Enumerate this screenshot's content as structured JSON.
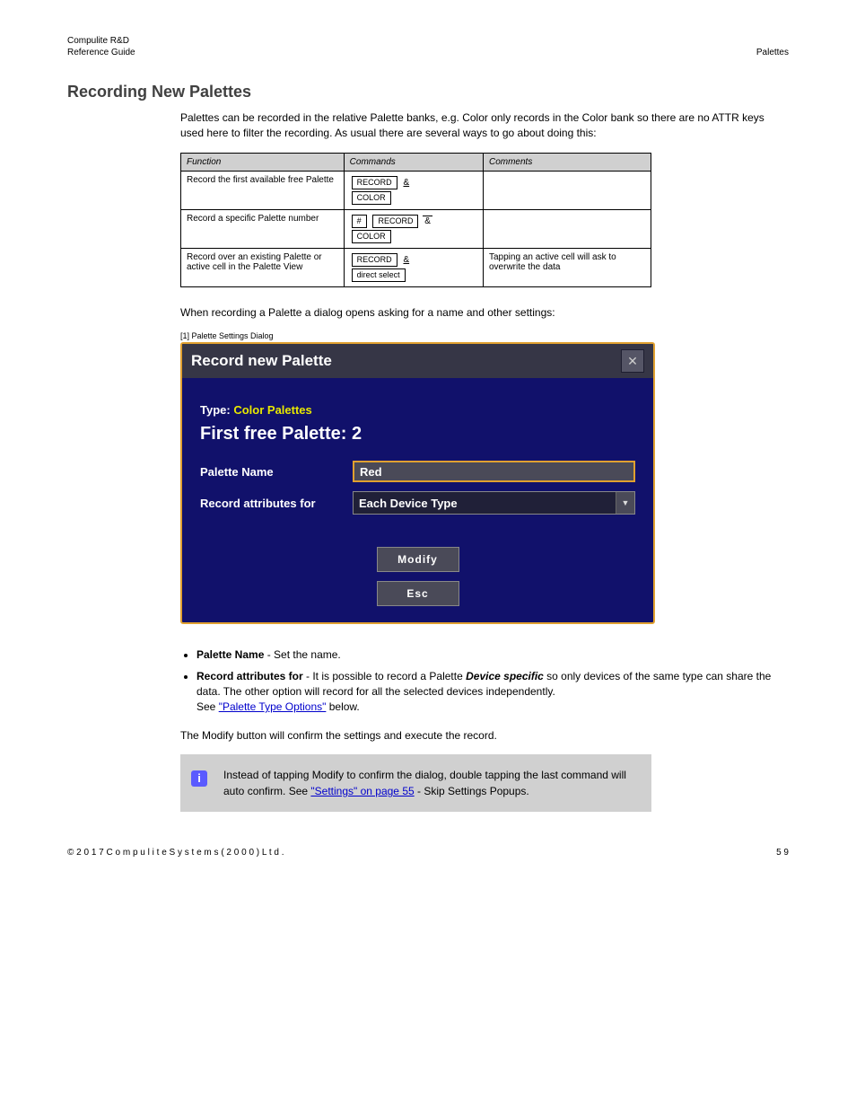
{
  "header": {
    "product": "Compulite R&D",
    "left": "Reference Guide",
    "right": "Palettes"
  },
  "section_title": "Recording New Palettes",
  "para1": "Palettes can be recorded in the relative Palette banks, e.g. Color only records in the Color bank so there are no ATTR keys used here to filter the recording. As usual there are several ways to go about doing this:",
  "table_headers": {
    "c1": "Function",
    "c2": "Commands",
    "c3": "Comments"
  },
  "rows": [
    {
      "func": "Record the first available free Palette",
      "keys_a": [
        "RECORD"
      ],
      "amp_a": "&",
      "keys_b": [
        "COLOR"
      ],
      "comment": ""
    },
    {
      "func": "Record a specific Palette number",
      "keys_a": [
        "#",
        "RECORD"
      ],
      "amp_a": "&",
      "overbar_a": true,
      "keys_b": [
        "COLOR"
      ],
      "comment": ""
    },
    {
      "func": "Record over an existing Palette or active cell in the Palette View",
      "keys_a": [
        "RECORD"
      ],
      "amp_a": "&",
      "keys_b": [
        "direct select"
      ],
      "comment": "Tapping an active cell will ask to overwrite the data"
    }
  ],
  "para2": "When recording a Palette a dialog opens asking for a name and other settings:",
  "dlg_label": "[1] Palette Settings Dialog",
  "dialog": {
    "title": "Record new Palette",
    "type_label": "Type:",
    "type_value": "Color Palettes",
    "first_free": "First free Palette: 2",
    "field_name_label": "Palette Name",
    "field_name_value": "Red",
    "field_attr_label": "Record attributes for",
    "field_attr_value": "Each Device Type",
    "btn_modify": "Modify",
    "btn_esc": "Esc"
  },
  "legend": [
    {
      "term": "Palette Name",
      "text": " - Set the name."
    },
    {
      "term": "Record attributes for",
      "pre": " - It is possible to record a Palette ",
      "ital": "Device specific",
      "post": " so only devices of the same type can share the data. The other option will record for all the selected devices independently."
    }
  ],
  "see_link_pre": "   See ",
  "see_link": "\"Palette Type Options\"",
  "see_link_post": " below.",
  "para3": "The Modify button will confirm the settings and execute the record.",
  "note": {
    "pre": "Instead of tapping Modify to confirm the dialog, double tapping the last command will auto confirm. See ",
    "link": "\"Settings\" on page 55",
    "post": " - Skip Settings Popups."
  },
  "footer": {
    "left": "© 2 0 1 7   C o m p u l i t e   S y s t e m s   ( 2 0 0 0 )   L t d .",
    "right": "5 9"
  }
}
